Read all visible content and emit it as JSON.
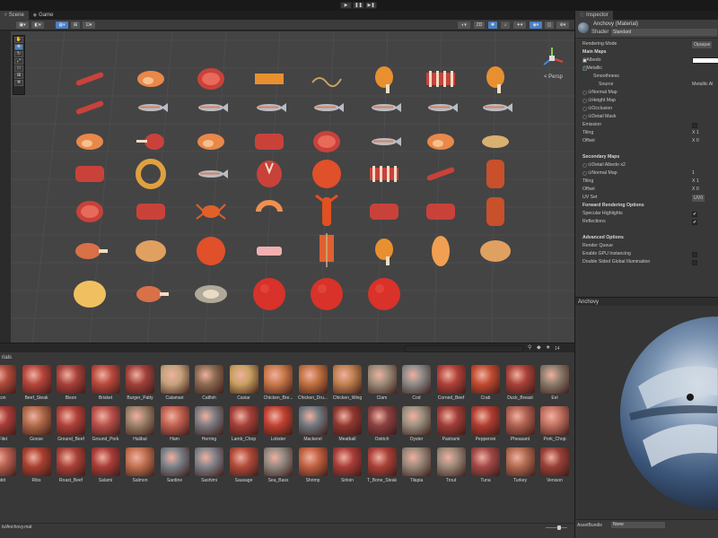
{
  "toolbar": {
    "play_icon": "play-icon",
    "pause_icon": "pause-icon",
    "step_icon": "step-icon"
  },
  "scene": {
    "tabs": [
      {
        "label": "Scene",
        "icon": "scene-icon",
        "active": true
      },
      {
        "label": "Game",
        "icon": "game-icon",
        "active": false
      }
    ],
    "persp_label": "< Persp",
    "colors": {
      "viewport_bg": "#444444",
      "grid": "#525252",
      "selection": "#4b7fc4"
    },
    "objects": [
      {
        "row": 0,
        "col": 0,
        "kind": "sausage"
      },
      {
        "row": 0,
        "col": 1,
        "kind": "salmon-steak"
      },
      {
        "row": 0,
        "col": 2,
        "kind": "steak"
      },
      {
        "row": 0,
        "col": 3,
        "kind": "bacon"
      },
      {
        "row": 0,
        "col": 4,
        "kind": "eel"
      },
      {
        "row": 0,
        "col": 5,
        "kind": "drumstick"
      },
      {
        "row": 0,
        "col": 6,
        "kind": "rib"
      },
      {
        "row": 0,
        "col": 7,
        "kind": "drumstick"
      },
      {
        "row": 1,
        "col": 0,
        "kind": "sausage"
      },
      {
        "row": 1,
        "col": 1,
        "kind": "fish"
      },
      {
        "row": 1,
        "col": 2,
        "kind": "fish"
      },
      {
        "row": 1,
        "col": 3,
        "kind": "fish"
      },
      {
        "row": 1,
        "col": 4,
        "kind": "fish"
      },
      {
        "row": 1,
        "col": 5,
        "kind": "fish"
      },
      {
        "row": 1,
        "col": 6,
        "kind": "fish"
      },
      {
        "row": 1,
        "col": 7,
        "kind": "fish"
      },
      {
        "row": 2,
        "col": 0,
        "kind": "salmon-steak"
      },
      {
        "row": 2,
        "col": 1,
        "kind": "lamb"
      },
      {
        "row": 2,
        "col": 2,
        "kind": "salmon-steak"
      },
      {
        "row": 2,
        "col": 3,
        "kind": "meat"
      },
      {
        "row": 2,
        "col": 4,
        "kind": "steak"
      },
      {
        "row": 2,
        "col": 5,
        "kind": "fish"
      },
      {
        "row": 2,
        "col": 6,
        "kind": "salmon-steak"
      },
      {
        "row": 2,
        "col": 7,
        "kind": "halibut"
      },
      {
        "row": 3,
        "col": 0,
        "kind": "meat"
      },
      {
        "row": 3,
        "col": 1,
        "kind": "ring"
      },
      {
        "row": 3,
        "col": 2,
        "kind": "fish"
      },
      {
        "row": 3,
        "col": 3,
        "kind": "t-bone"
      },
      {
        "row": 3,
        "col": 4,
        "kind": "patty"
      },
      {
        "row": 3,
        "col": 5,
        "kind": "ribs"
      },
      {
        "row": 3,
        "col": 6,
        "kind": "sausage"
      },
      {
        "row": 3,
        "col": 7,
        "kind": "roast"
      },
      {
        "row": 4,
        "col": 0,
        "kind": "steak"
      },
      {
        "row": 4,
        "col": 1,
        "kind": "meat"
      },
      {
        "row": 4,
        "col": 2,
        "kind": "crab"
      },
      {
        "row": 4,
        "col": 3,
        "kind": "shrimp"
      },
      {
        "row": 4,
        "col": 4,
        "kind": "lobster"
      },
      {
        "row": 4,
        "col": 5,
        "kind": "meat"
      },
      {
        "row": 4,
        "col": 6,
        "kind": "meat"
      },
      {
        "row": 4,
        "col": 7,
        "kind": "roast"
      },
      {
        "row": 5,
        "col": 0,
        "kind": "ham"
      },
      {
        "row": 5,
        "col": 1,
        "kind": "chicken"
      },
      {
        "row": 5,
        "col": 2,
        "kind": "patty"
      },
      {
        "row": 5,
        "col": 3,
        "kind": "bone"
      },
      {
        "row": 5,
        "col": 4,
        "kind": "kebab"
      },
      {
        "row": 5,
        "col": 5,
        "kind": "drumstick"
      },
      {
        "row": 5,
        "col": 6,
        "kind": "breast"
      },
      {
        "row": 5,
        "col": 7,
        "kind": "chicken"
      },
      {
        "row": 6,
        "col": 0,
        "kind": "bread"
      },
      {
        "row": 6,
        "col": 1,
        "kind": "ham"
      },
      {
        "row": 6,
        "col": 2,
        "kind": "oyster"
      },
      {
        "row": 6,
        "col": 3,
        "kind": "meatball"
      },
      {
        "row": 6,
        "col": 4,
        "kind": "meatball"
      },
      {
        "row": 6,
        "col": 5,
        "kind": "meatball"
      }
    ]
  },
  "project": {
    "breadcrumb": "rials",
    "search_placeholder": "",
    "item_count": "14",
    "footer_path": "ls/Anchovy.mat",
    "assets": [
      {
        "label": "icon",
        "tint": "#b04a3a"
      },
      {
        "label": "Beef_Steak",
        "tint": "#b5443a"
      },
      {
        "label": "Bison",
        "tint": "#a8403a"
      },
      {
        "label": "Brisket",
        "tint": "#b8483c"
      },
      {
        "label": "Burger_Patty",
        "tint": "#a0403a"
      },
      {
        "label": "Calamari",
        "tint": "#c4a27c"
      },
      {
        "label": "Catfish",
        "tint": "#8a6a50"
      },
      {
        "label": "Caviar",
        "tint": "#c8a060"
      },
      {
        "label": "Chicken_Bre...",
        "tint": "#c87848"
      },
      {
        "label": "Chicken_Dru...",
        "tint": "#c07040"
      },
      {
        "label": "Chicken_Wing",
        "tint": "#c08050"
      },
      {
        "label": "Clam",
        "tint": "#9a8a78"
      },
      {
        "label": "Cod",
        "tint": "#8a8a88"
      },
      {
        "label": "Corned_Beef",
        "tint": "#b04038"
      },
      {
        "label": "Crab",
        "tint": "#c04a30"
      },
      {
        "label": "Duck_Breast",
        "tint": "#a84038"
      },
      {
        "label": "Eel",
        "tint": "#8a7a6a"
      },
      {
        "label": "_Filet",
        "tint": "#a83c38"
      },
      {
        "label": "Goose",
        "tint": "#b06a48"
      },
      {
        "label": "Ground_Beef",
        "tint": "#b04038"
      },
      {
        "label": "Ground_Pork",
        "tint": "#b8504a"
      },
      {
        "label": "Halibut",
        "tint": "#9a8068"
      },
      {
        "label": "Ham",
        "tint": "#c06050"
      },
      {
        "label": "Herring",
        "tint": "#7a7a80"
      },
      {
        "label": "Lamb_Chop",
        "tint": "#a44038"
      },
      {
        "label": "Lobster",
        "tint": "#c04030"
      },
      {
        "label": "Mackerel",
        "tint": "#707880"
      },
      {
        "label": "Meatball",
        "tint": "#903830"
      },
      {
        "label": "Ostrich",
        "tint": "#8a4040"
      },
      {
        "label": "Oyster",
        "tint": "#9a9080"
      },
      {
        "label": "Pastrami",
        "tint": "#a03c38"
      },
      {
        "label": "Pepperoni",
        "tint": "#b03c30"
      },
      {
        "label": "Pheasant",
        "tint": "#b06050"
      },
      {
        "label": "Pork_Chop",
        "tint": "#c07060"
      },
      {
        "label": "bbit",
        "tint": "#b86050"
      },
      {
        "label": "Ribs",
        "tint": "#a84030"
      },
      {
        "label": "Roast_Beef",
        "tint": "#a84038"
      },
      {
        "label": "Salami",
        "tint": "#a83c38"
      },
      {
        "label": "Salmon",
        "tint": "#c07050"
      },
      {
        "label": "Sardine",
        "tint": "#7a8088"
      },
      {
        "label": "Sashimi",
        "tint": "#80828a"
      },
      {
        "label": "Sausage",
        "tint": "#b04a38"
      },
      {
        "label": "Sea_Bass",
        "tint": "#908880"
      },
      {
        "label": "Shrimp",
        "tint": "#c06040"
      },
      {
        "label": "Sirloin",
        "tint": "#a83c38"
      },
      {
        "label": "T_Bone_Steak",
        "tint": "#a84038"
      },
      {
        "label": "Tilapia",
        "tint": "#98887a"
      },
      {
        "label": "Trout",
        "tint": "#9a8878"
      },
      {
        "label": "Tuna",
        "tint": "#a04848"
      },
      {
        "label": "Turkey",
        "tint": "#b06a50"
      },
      {
        "label": "Venison",
        "tint": "#984038"
      }
    ]
  },
  "inspector": {
    "tab_label": "Inspector",
    "tab_icon": "inspector-icon",
    "material_name": "Anchovy (Material)",
    "shader_label": "Shader",
    "shader_value": "Standard",
    "rows": [
      {
        "label": "Rendering Mode",
        "value": "Opaque",
        "type": "dropdown"
      },
      {
        "label": "Main Maps",
        "value": "",
        "type": "header"
      },
      {
        "label": "⊙Albedo",
        "value": "",
        "type": "color"
      },
      {
        "label": "⊙Metallic",
        "value": "",
        "type": "slider"
      },
      {
        "label": "Smoothness",
        "value": "",
        "type": "indent"
      },
      {
        "label": "Source",
        "value": "Metallic Al",
        "type": "indent2"
      },
      {
        "label": "⊙Normal Map",
        "value": "",
        "type": "map"
      },
      {
        "label": "⊙Height Map",
        "value": "",
        "type": "map"
      },
      {
        "label": "⊙Occlusion",
        "value": "",
        "type": "map"
      },
      {
        "label": "⊙Detail Mask",
        "value": "",
        "type": "map"
      },
      {
        "label": "Emission",
        "value": "",
        "type": "check-off"
      },
      {
        "label": "Tiling",
        "value": "X 1",
        "type": "field"
      },
      {
        "label": "Offset",
        "value": "X 0",
        "type": "field"
      },
      {
        "label": "",
        "value": "",
        "type": "spacer"
      },
      {
        "label": "Secondary Maps",
        "value": "",
        "type": "header"
      },
      {
        "label": "⊙Detail Albedo x2",
        "value": "",
        "type": "map"
      },
      {
        "label": "⊙Normal Map",
        "value": "1",
        "type": "map-field"
      },
      {
        "label": "Tiling",
        "value": "X 1",
        "type": "field"
      },
      {
        "label": "Offset",
        "value": "X 0",
        "type": "field"
      },
      {
        "label": "UV Set",
        "value": "UV0",
        "type": "dropdown"
      },
      {
        "label": "Forward Rendering Options",
        "value": "",
        "type": "header"
      },
      {
        "label": "Specular Highlights",
        "value": "✔",
        "type": "check"
      },
      {
        "label": "Reflections",
        "value": "✔",
        "type": "check"
      },
      {
        "label": "",
        "value": "",
        "type": "spacer"
      },
      {
        "label": "Advanced Options",
        "value": "",
        "type": "header"
      },
      {
        "label": "Render Queue",
        "value": "",
        "type": "plain"
      },
      {
        "label": "Enable GPU Instancing",
        "value": "",
        "type": "check-off"
      },
      {
        "label": "Double Sided Global Illumination",
        "value": "",
        "type": "check-off"
      }
    ],
    "preview_title": "Anchovy",
    "assetbundle_label": "AssetBundle",
    "assetbundle_value": "None"
  }
}
